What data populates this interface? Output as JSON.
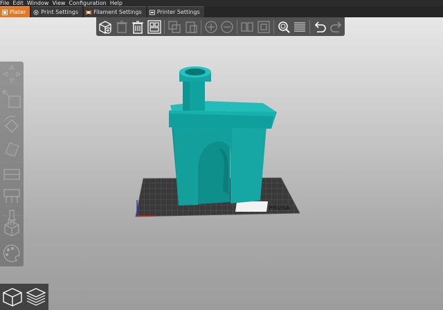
{
  "menu": [
    "File",
    "Edit",
    "Window",
    "View",
    "Configuration",
    "Help"
  ],
  "tabs": [
    {
      "label": "Plater",
      "icon": "plater-icon",
      "active": true
    },
    {
      "label": "Print Settings",
      "icon": "gear-icon",
      "active": false
    },
    {
      "label": "Filament Settings",
      "icon": "filament-spool-icon",
      "active": false
    },
    {
      "label": "Printer Settings",
      "icon": "printer-icon",
      "active": false
    }
  ],
  "toolbar": [
    "add-icon",
    "delete-icon",
    "delete-all-icon",
    "arrange-icon",
    "copy-icon",
    "paste-icon",
    "add-instance-icon",
    "remove-instance-icon",
    "split-objects-icon",
    "split-parts-icon",
    "search-icon",
    "layers-editing-icon",
    "undo-icon",
    "redo-icon"
  ],
  "left_tools": [
    "move-icon",
    "scale-icon",
    "rotate-icon",
    "place-on-face-icon",
    "cut-icon",
    "paint-supports-icon",
    "seam-painting-icon",
    "hollow-icon",
    "multimaterial-painting-icon"
  ],
  "view_switch": [
    "3d-view-icon",
    "preview-layers-icon"
  ],
  "bed_logo": "PRUSA",
  "colors": {
    "model": "#14a3a0",
    "accent": "#e07828",
    "bed": "#3c3c3c"
  }
}
